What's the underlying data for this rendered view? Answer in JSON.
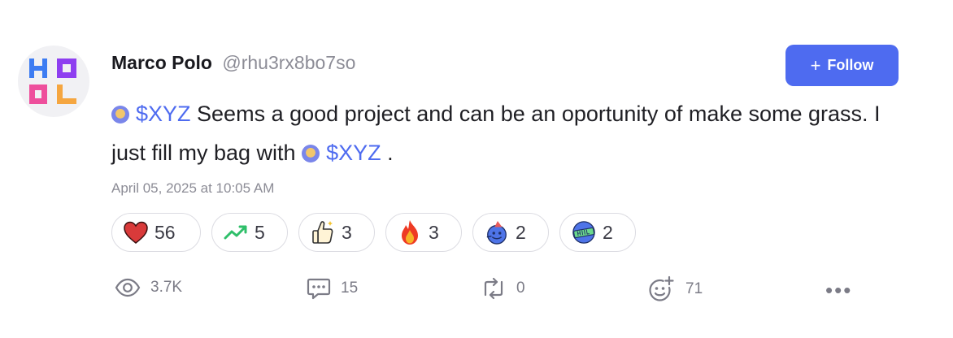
{
  "avatar": {
    "logo_text": "HODL",
    "colors": [
      "#3d7cf2",
      "#8e3ff0",
      "#ee4f9c",
      "#f5a640"
    ]
  },
  "post": {
    "author_name": "Marco Polo",
    "author_handle": "@rhu3rx8bo7so",
    "follow_label": "Follow",
    "body": {
      "ticker_1": "$XYZ",
      "text_1": " Seems a good project and can be an oportunity of make some grass. I just fill my bag with ",
      "ticker_2": "$XYZ",
      "text_2": " ."
    },
    "timestamp": "April 05, 2025 at 10:05 AM"
  },
  "reactions": [
    {
      "icon": "heart-icon",
      "count": "56"
    },
    {
      "icon": "trending-up-icon",
      "count": "5"
    },
    {
      "icon": "thumbs-up-icon",
      "count": "3"
    },
    {
      "icon": "fire-icon",
      "count": "3"
    },
    {
      "icon": "party-face-icon",
      "count": "2"
    },
    {
      "icon": "hodl-globe-icon",
      "count": "2"
    }
  ],
  "actions": {
    "views": "3.7K",
    "comments": "15",
    "reposts": "0",
    "reacts": "71"
  },
  "colors": {
    "accent": "#4e6bf0",
    "muted": "#8c8c96"
  }
}
